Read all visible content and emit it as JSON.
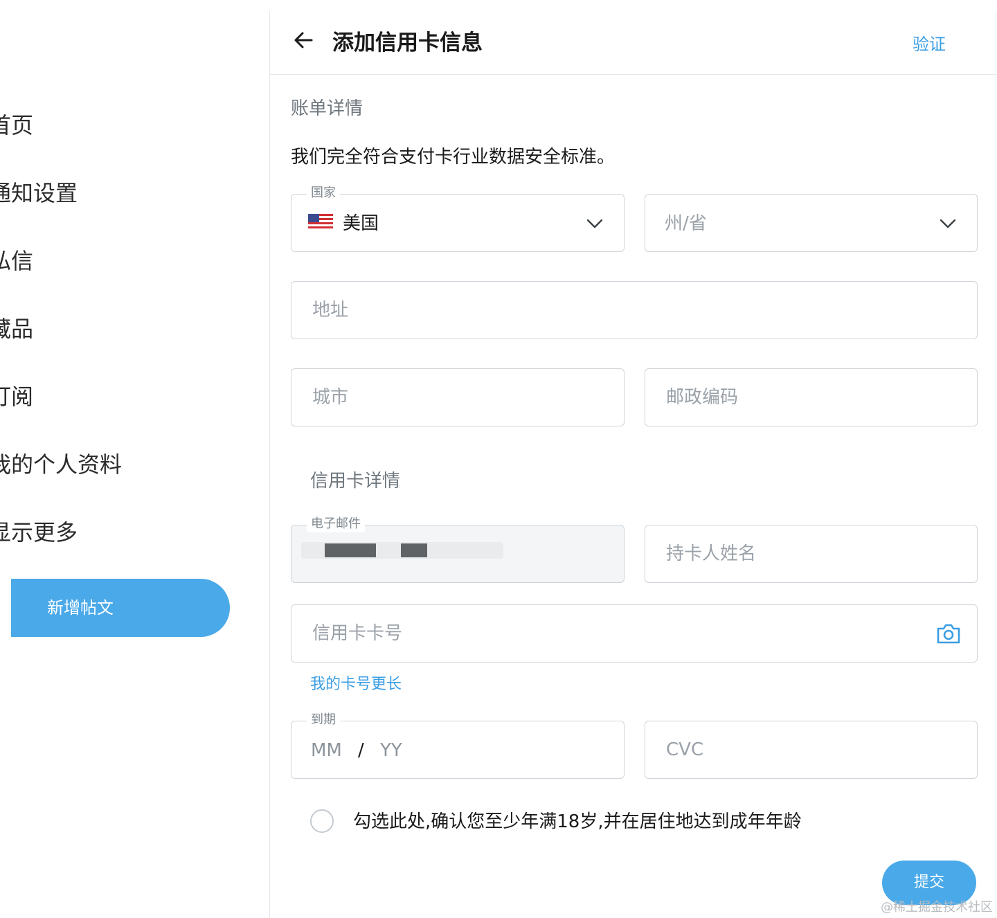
{
  "nav": {
    "items": [
      {
        "label": "首页"
      },
      {
        "label": "通知设置"
      },
      {
        "label": "私信"
      },
      {
        "label": "藏品"
      },
      {
        "label": "订阅"
      },
      {
        "label": "我的个人资料"
      },
      {
        "label": "显示更多"
      }
    ],
    "post_button": "新增帖文"
  },
  "header": {
    "title": "添加信用卡信息",
    "verify": "验证"
  },
  "billing": {
    "section_label": "账单详情",
    "security_text": "我们完全符合支付卡行业数据安全标准。",
    "country": {
      "legend": "国家",
      "value": "美国",
      "flag_icon": "us-flag-icon"
    },
    "state": {
      "placeholder": "州/省"
    },
    "address": {
      "placeholder": "地址"
    },
    "city": {
      "placeholder": "城市"
    },
    "zip": {
      "placeholder": "邮政编码"
    }
  },
  "card": {
    "section_label": "信用卡详情",
    "email": {
      "legend": "电子邮件"
    },
    "cardholder": {
      "placeholder": "持卡人姓名"
    },
    "number": {
      "placeholder": "信用卡卡号",
      "icon": "camera-icon"
    },
    "longer_link": "我的卡号更长",
    "expiry": {
      "legend": "到期",
      "mm": "MM",
      "slash": "/",
      "yy": "YY"
    },
    "cvc": {
      "placeholder": "CVC"
    }
  },
  "age_confirm": "勾选此处,确认您至少年满18岁,并在居住地达到成年年龄",
  "submit": "提交",
  "watermark": "@稀土掘金技术社区",
  "colors": {
    "accent": "#4aa9e9",
    "link": "#3a9ee4",
    "border": "#cfd5da"
  }
}
